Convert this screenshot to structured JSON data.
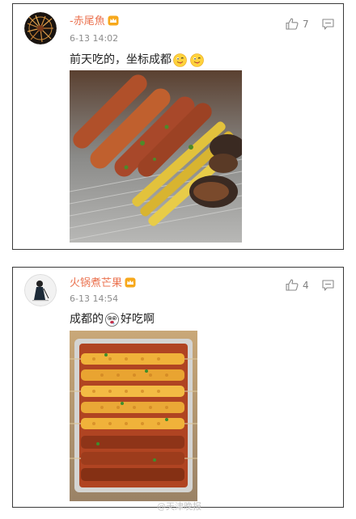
{
  "comments": [
    {
      "username": "-赤尾魚",
      "timestamp": "6-13 14:02",
      "like_count": "7",
      "text_before_emoji": "前天吃的，坐标成都",
      "text_after_emoji": "",
      "emojis": [
        "tongue-out-emoji",
        "tongue-out-emoji"
      ],
      "image_subject": "grilled skewers: sausages, corn and eggplant"
    },
    {
      "username": "火锅煮芒果",
      "timestamp": "6-13 14:54",
      "like_count": "4",
      "text_before_emoji": "成都的",
      "text_after_emoji": "好吃啊",
      "emojis": [
        "drooling-emoji"
      ],
      "image_subject": "spicy corn and meat skewers in a foil tray"
    }
  ],
  "watermark": "@天津晚报",
  "colors": {
    "username": "#eb7350",
    "timestamp": "#8c8c8c",
    "card_border": "#3a3a3a",
    "icon": "#8a8a8a"
  },
  "icons": {
    "like": "thumbs-up-icon",
    "comment": "comment-icon",
    "badge": "crown-icon"
  }
}
